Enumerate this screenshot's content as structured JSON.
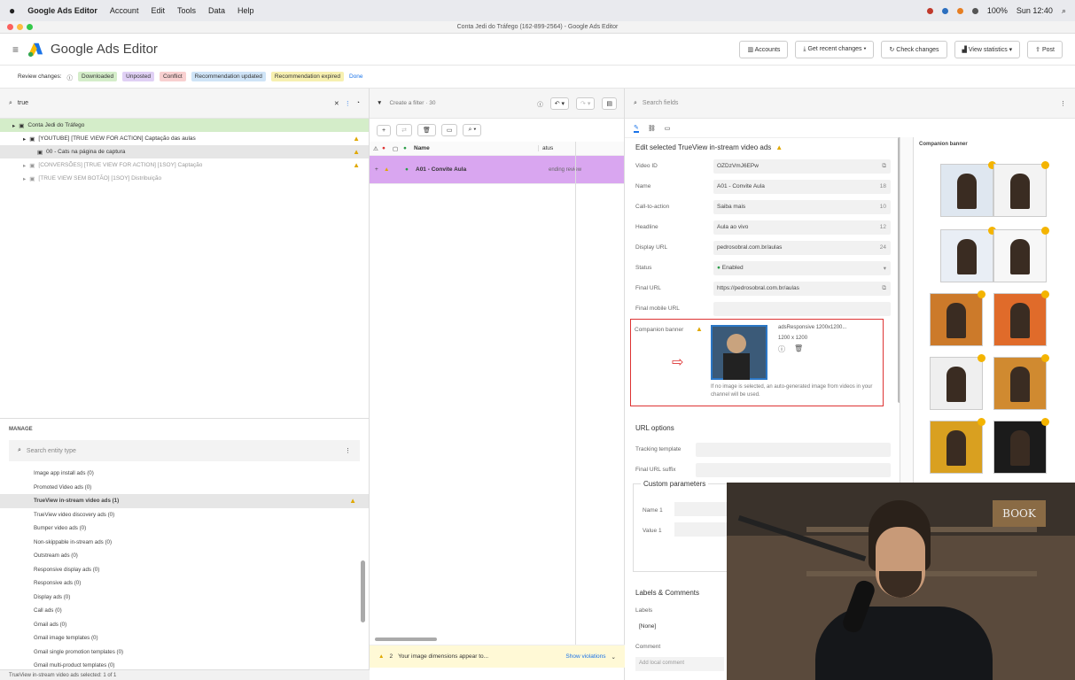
{
  "menubar": {
    "app": "Google Ads Editor",
    "items": [
      "Account",
      "Edit",
      "Tools",
      "Data",
      "Help"
    ],
    "zoom": "100%",
    "clock": "Sun 12:40"
  },
  "window": {
    "title": "Conta Jedi do Tráfego (162-899-2564) - Google Ads Editor"
  },
  "header": {
    "app_name": "Google Ads Editor",
    "buttons": [
      "Accounts",
      "Get recent changes",
      "Check changes",
      "View statistics",
      "Post"
    ]
  },
  "review": {
    "label": "Review changes:",
    "chips": [
      {
        "text": "Downloaded",
        "bg": "#d4edc9"
      },
      {
        "text": "Unposted",
        "bg": "#e0d0f5"
      },
      {
        "text": "Conflict",
        "bg": "#f8d0d0"
      },
      {
        "text": "Recommendation updated",
        "bg": "#cfe4f7"
      },
      {
        "text": "Recommendation expired",
        "bg": "#f7f0b0"
      }
    ],
    "done": "Done"
  },
  "tree": {
    "search_value": "true",
    "items": [
      {
        "text": "Conta Jedi do Tráfego",
        "indent": 0,
        "hl": true
      },
      {
        "text": "[YOUTUBE] [TRUE VIEW FOR ACTION] Captação das aulas",
        "indent": 1,
        "warn": true
      },
      {
        "text": "00 - Cats na página de captura",
        "indent": 2,
        "warn": true,
        "sel": true
      },
      {
        "text": "[CONVERSÕES] [TRUE VIEW FOR ACTION] [1SOY] Captação",
        "indent": 1,
        "warn": true,
        "muted": true
      },
      {
        "text": "[TRUE VIEW SEM BOTÃO] [1SOY] Distribuição",
        "indent": 1,
        "muted": true
      }
    ]
  },
  "manage": {
    "title": "MANAGE",
    "search_placeholder": "Search entity type",
    "items": [
      "Image app install ads (0)",
      "Promoted Video ads (0)",
      "TrueView in-stream video ads (1)",
      "TrueView video discovery ads (0)",
      "Bumper video ads (0)",
      "Non-skippable in-stream ads (0)",
      "Outstream ads (0)",
      "Responsive display ads (0)",
      "Responsive ads (0)",
      "Display ads (0)",
      "Call ads (0)",
      "Gmail ads (0)",
      "Gmail image templates (0)",
      "Gmail single promotion templates (0)",
      "Gmail multi-product templates (0)"
    ],
    "selected_index": 2
  },
  "statusbar": "TrueView in-stream video ads selected: 1 of 1",
  "grid": {
    "filter_placeholder": "Create a filter · 30",
    "col_name": "Name",
    "col_status": "atus",
    "row_name": "A01 - Convite Aula",
    "row_status": "ending review",
    "warning_count": "2",
    "warning_text": "Your image dimensions appear to...",
    "show_violations": "Show violations"
  },
  "edit": {
    "search_placeholder": "Search fields",
    "title": "Edit selected TrueView in-stream video ads",
    "fields": [
      {
        "label": "Video ID",
        "value": "OZDzVmJ6EPw",
        "suffix": "⧉"
      },
      {
        "label": "Name",
        "value": "A01 - Convite Aula",
        "suffix": "18"
      },
      {
        "label": "Call-to-action",
        "value": "Saiba mais",
        "suffix": "10"
      },
      {
        "label": "Headline",
        "value": "Aula ao vivo",
        "suffix": "12"
      },
      {
        "label": "Display URL",
        "value": "pedrosobral.com.br/aulas",
        "suffix": "24"
      },
      {
        "label": "Status",
        "value": "Enabled",
        "suffix": "▾"
      },
      {
        "label": "Final URL",
        "value": "https://pedrosobral.com.br/aulas",
        "suffix": "⧉"
      },
      {
        "label": "Final mobile URL",
        "value": "",
        "suffix": ""
      }
    ],
    "companion_label": "Companion banner",
    "companion_name": "adsResponsive 1200x1200...",
    "companion_size": "1200 x 1200",
    "companion_note": "If no image is selected, an auto-generated image from videos in your channel will be used.",
    "url_options": "URL options",
    "tracking_template": "Tracking template",
    "final_url_suffix": "Final URL suffix",
    "custom_params": "Custom parameters",
    "name1": "Name 1",
    "value1": "Value 1",
    "labels_comments": "Labels & Comments",
    "labels": "Labels",
    "labels_value": "[None]",
    "comment": "Comment",
    "comment_placeholder": "Add local comment"
  },
  "companion_panel": {
    "title": "Companion banner"
  },
  "colors": {
    "selected_row": "#d9a6f0",
    "tree_hl": "#d4edc9",
    "accent_blue": "#1a73e8",
    "warning": "#e0a800",
    "red_box": "#d33"
  }
}
